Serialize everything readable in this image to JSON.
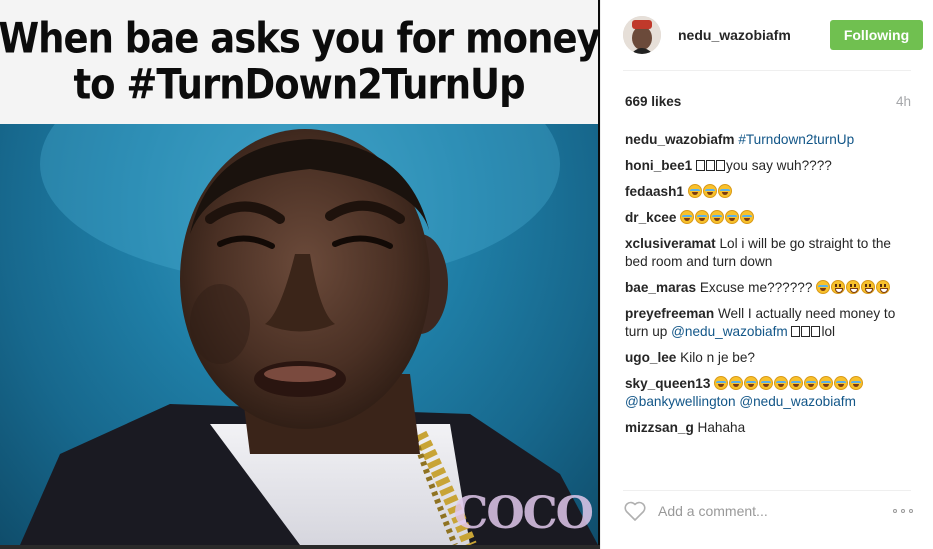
{
  "post": {
    "caption_image": {
      "line1": "When bae asks you for money",
      "line2": "to #TurnDown2TurnUp",
      "watermark": "COCO"
    },
    "author": {
      "username": "nedu_wazobiafm",
      "avatar_icon": "avatar-photo"
    },
    "follow_label": "Following",
    "likes": "669 likes",
    "time_ago": "4h",
    "caption": {
      "user": "nedu_wazobiafm",
      "hashtag": "#Turndown2turnUp"
    },
    "comments": [
      {
        "user": "honi_bee1",
        "text": "you say wuh????"
      },
      {
        "user": "fedaash1",
        "text": ""
      },
      {
        "user": "dr_kcee",
        "text": ""
      },
      {
        "user": "xclusiveramat",
        "text": "Lol i will be go straight to the bed room and turn down"
      },
      {
        "user": "bae_maras",
        "text": "Excuse me??????"
      },
      {
        "user": "preyefreeman",
        "text": "Well I actually need money to turn up",
        "mention": "@nedu_wazobiafm",
        "tail": "lol"
      },
      {
        "user": "ugo_lee",
        "text": "Kilo n je be?"
      },
      {
        "user": "sky_queen13",
        "mention1": "@bankywellington",
        "mention2": "@nedu_wazobiafm"
      },
      {
        "user": "mizzsan_g",
        "text": "Hahaha"
      }
    ],
    "add_comment_placeholder": "Add a comment...",
    "icons": [
      "heart-icon",
      "more-options-icon",
      "laugh-emoji-icon",
      "grin-emoji-icon"
    ],
    "colors": {
      "follow_button": "#70c050",
      "link": "#125688",
      "meta_gray": "#a5a7aa",
      "photo_background": "#1f7ea6"
    }
  }
}
